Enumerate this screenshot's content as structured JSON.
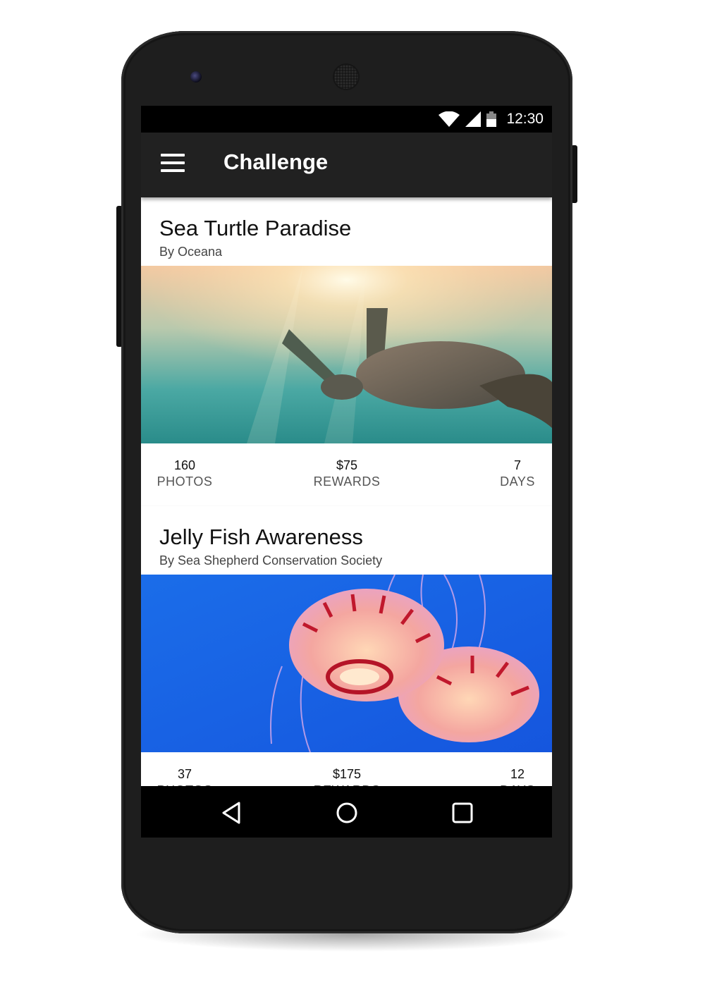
{
  "status_bar": {
    "time": "12:30",
    "icons": [
      "wifi-icon",
      "cell-signal-icon",
      "battery-icon"
    ]
  },
  "app_bar": {
    "title": "Challenge",
    "menu_icon": "hamburger-menu-icon"
  },
  "challenges": [
    {
      "title": "Sea Turtle Paradise",
      "author": "By Oceana",
      "image": "sea turtle underwater",
      "stats": [
        {
          "value": "160",
          "label": "PHOTOS"
        },
        {
          "value": "$75",
          "label": "REWARDS"
        },
        {
          "value": "7",
          "label": "DAYS"
        }
      ]
    },
    {
      "title": "Jelly Fish Awareness",
      "author": "By Sea Shepherd Conservation Society",
      "image": "jellyfish on blue",
      "stats": [
        {
          "value": "37",
          "label": "PHOTOS"
        },
        {
          "value": "$175",
          "label": "REWARDS"
        },
        {
          "value": "12",
          "label": "DAYS"
        }
      ]
    }
  ],
  "nav_bar": {
    "icons": [
      "back-icon",
      "home-icon",
      "recents-icon"
    ]
  },
  "colors": {
    "app_bar": "#212121",
    "status_bar": "#000000",
    "phone_body": "#1e1e1e",
    "jelly_background": "#1565e8"
  }
}
